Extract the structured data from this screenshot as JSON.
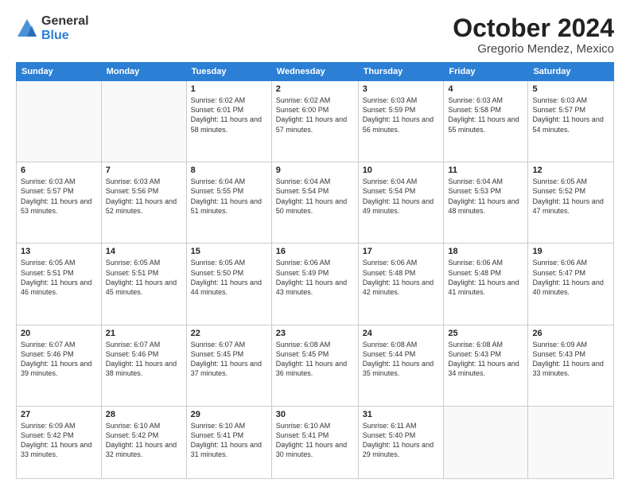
{
  "logo": {
    "general": "General",
    "blue": "Blue"
  },
  "title": "October 2024",
  "subtitle": "Gregorio Mendez, Mexico",
  "days_of_week": [
    "Sunday",
    "Monday",
    "Tuesday",
    "Wednesday",
    "Thursday",
    "Friday",
    "Saturday"
  ],
  "weeks": [
    [
      {
        "num": "",
        "info": ""
      },
      {
        "num": "",
        "info": ""
      },
      {
        "num": "1",
        "info": "Sunrise: 6:02 AM\nSunset: 6:01 PM\nDaylight: 11 hours and 58 minutes."
      },
      {
        "num": "2",
        "info": "Sunrise: 6:02 AM\nSunset: 6:00 PM\nDaylight: 11 hours and 57 minutes."
      },
      {
        "num": "3",
        "info": "Sunrise: 6:03 AM\nSunset: 5:59 PM\nDaylight: 11 hours and 56 minutes."
      },
      {
        "num": "4",
        "info": "Sunrise: 6:03 AM\nSunset: 5:58 PM\nDaylight: 11 hours and 55 minutes."
      },
      {
        "num": "5",
        "info": "Sunrise: 6:03 AM\nSunset: 5:57 PM\nDaylight: 11 hours and 54 minutes."
      }
    ],
    [
      {
        "num": "6",
        "info": "Sunrise: 6:03 AM\nSunset: 5:57 PM\nDaylight: 11 hours and 53 minutes."
      },
      {
        "num": "7",
        "info": "Sunrise: 6:03 AM\nSunset: 5:56 PM\nDaylight: 11 hours and 52 minutes."
      },
      {
        "num": "8",
        "info": "Sunrise: 6:04 AM\nSunset: 5:55 PM\nDaylight: 11 hours and 51 minutes."
      },
      {
        "num": "9",
        "info": "Sunrise: 6:04 AM\nSunset: 5:54 PM\nDaylight: 11 hours and 50 minutes."
      },
      {
        "num": "10",
        "info": "Sunrise: 6:04 AM\nSunset: 5:54 PM\nDaylight: 11 hours and 49 minutes."
      },
      {
        "num": "11",
        "info": "Sunrise: 6:04 AM\nSunset: 5:53 PM\nDaylight: 11 hours and 48 minutes."
      },
      {
        "num": "12",
        "info": "Sunrise: 6:05 AM\nSunset: 5:52 PM\nDaylight: 11 hours and 47 minutes."
      }
    ],
    [
      {
        "num": "13",
        "info": "Sunrise: 6:05 AM\nSunset: 5:51 PM\nDaylight: 11 hours and 46 minutes."
      },
      {
        "num": "14",
        "info": "Sunrise: 6:05 AM\nSunset: 5:51 PM\nDaylight: 11 hours and 45 minutes."
      },
      {
        "num": "15",
        "info": "Sunrise: 6:05 AM\nSunset: 5:50 PM\nDaylight: 11 hours and 44 minutes."
      },
      {
        "num": "16",
        "info": "Sunrise: 6:06 AM\nSunset: 5:49 PM\nDaylight: 11 hours and 43 minutes."
      },
      {
        "num": "17",
        "info": "Sunrise: 6:06 AM\nSunset: 5:48 PM\nDaylight: 11 hours and 42 minutes."
      },
      {
        "num": "18",
        "info": "Sunrise: 6:06 AM\nSunset: 5:48 PM\nDaylight: 11 hours and 41 minutes."
      },
      {
        "num": "19",
        "info": "Sunrise: 6:06 AM\nSunset: 5:47 PM\nDaylight: 11 hours and 40 minutes."
      }
    ],
    [
      {
        "num": "20",
        "info": "Sunrise: 6:07 AM\nSunset: 5:46 PM\nDaylight: 11 hours and 39 minutes."
      },
      {
        "num": "21",
        "info": "Sunrise: 6:07 AM\nSunset: 5:46 PM\nDaylight: 11 hours and 38 minutes."
      },
      {
        "num": "22",
        "info": "Sunrise: 6:07 AM\nSunset: 5:45 PM\nDaylight: 11 hours and 37 minutes."
      },
      {
        "num": "23",
        "info": "Sunrise: 6:08 AM\nSunset: 5:45 PM\nDaylight: 11 hours and 36 minutes."
      },
      {
        "num": "24",
        "info": "Sunrise: 6:08 AM\nSunset: 5:44 PM\nDaylight: 11 hours and 35 minutes."
      },
      {
        "num": "25",
        "info": "Sunrise: 6:08 AM\nSunset: 5:43 PM\nDaylight: 11 hours and 34 minutes."
      },
      {
        "num": "26",
        "info": "Sunrise: 6:09 AM\nSunset: 5:43 PM\nDaylight: 11 hours and 33 minutes."
      }
    ],
    [
      {
        "num": "27",
        "info": "Sunrise: 6:09 AM\nSunset: 5:42 PM\nDaylight: 11 hours and 33 minutes."
      },
      {
        "num": "28",
        "info": "Sunrise: 6:10 AM\nSunset: 5:42 PM\nDaylight: 11 hours and 32 minutes."
      },
      {
        "num": "29",
        "info": "Sunrise: 6:10 AM\nSunset: 5:41 PM\nDaylight: 11 hours and 31 minutes."
      },
      {
        "num": "30",
        "info": "Sunrise: 6:10 AM\nSunset: 5:41 PM\nDaylight: 11 hours and 30 minutes."
      },
      {
        "num": "31",
        "info": "Sunrise: 6:11 AM\nSunset: 5:40 PM\nDaylight: 11 hours and 29 minutes."
      },
      {
        "num": "",
        "info": ""
      },
      {
        "num": "",
        "info": ""
      }
    ]
  ]
}
